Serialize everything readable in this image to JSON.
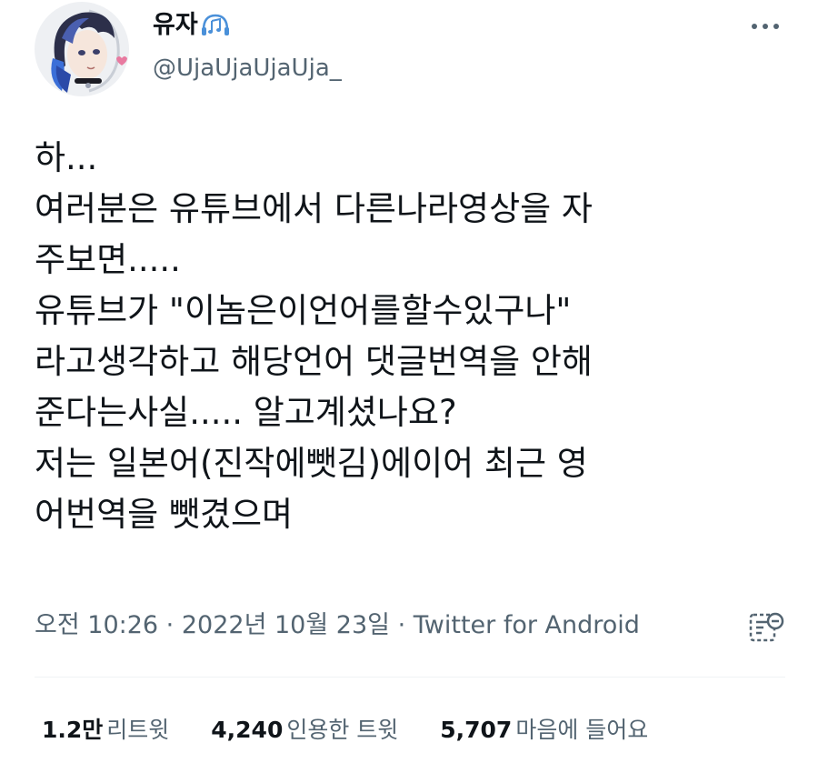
{
  "user": {
    "display_name": "유자",
    "handle": "@UjaUjaUjaUja_",
    "name_icon": "music-note-icon",
    "avatar_icon": "anime-character-avatar"
  },
  "tweet": {
    "lines": [
      "하...",
      "여러분은 유튜브에서 다른나라영상을 자",
      "주보면.....",
      "유튜브가 \"이놈은이언어를할수있구나\"",
      "라고생각하고 해당언어 댓글번역을 안해",
      "준다는사실..... 알고계셨나요?",
      "저는 일본어(진작에뺏김)에이어 최근 영",
      "어번역을 뺏겼으며"
    ]
  },
  "meta": {
    "time": "오전 10:26",
    "separator": "·",
    "date": "2022년 10월 23일",
    "source": "Twitter for Android"
  },
  "stats": {
    "retweets": {
      "value": "1.2만",
      "label": "리트윗"
    },
    "quotes": {
      "value": "4,240",
      "label": "인용한 트윗"
    },
    "likes": {
      "value": "5,707",
      "label": "마음에 들어요"
    }
  },
  "colors": {
    "text": "#0f1419",
    "secondary": "#536471",
    "divider": "#eff3f4",
    "accent": "#1d9bf0"
  },
  "icons": {
    "more": "more-horizontal-icon",
    "translate": "view-analytics-icon"
  }
}
